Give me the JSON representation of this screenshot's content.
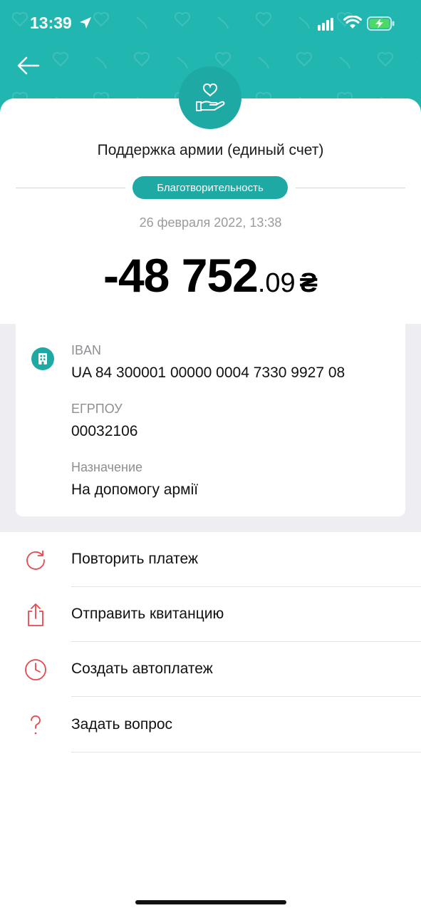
{
  "status_bar": {
    "time": "13:39"
  },
  "transaction": {
    "merchant": "Поддержка армии (единый счет)",
    "category": "Благотворительность",
    "datetime": "26 февраля 2022, 13:38",
    "amount_main": "-48 752",
    "amount_fraction": ".09",
    "currency": "₴"
  },
  "details": [
    {
      "label": "IBAN",
      "value": "UA 84 300001 00000 0004 7330 9927 08"
    },
    {
      "label": "ЕГРПОУ",
      "value": "00032106"
    },
    {
      "label": "Назначение",
      "value": "На допомогу армії"
    }
  ],
  "actions": [
    {
      "label": "Повторить платеж",
      "icon": "repeat-icon"
    },
    {
      "label": "Отправить квитанцию",
      "icon": "share-icon"
    },
    {
      "label": "Создать автоплатеж",
      "icon": "clock-icon"
    },
    {
      "label": "Задать вопрос",
      "icon": "question-icon"
    }
  ],
  "colors": {
    "accent": "#22b6b1",
    "action_icon": "#e5484d"
  }
}
